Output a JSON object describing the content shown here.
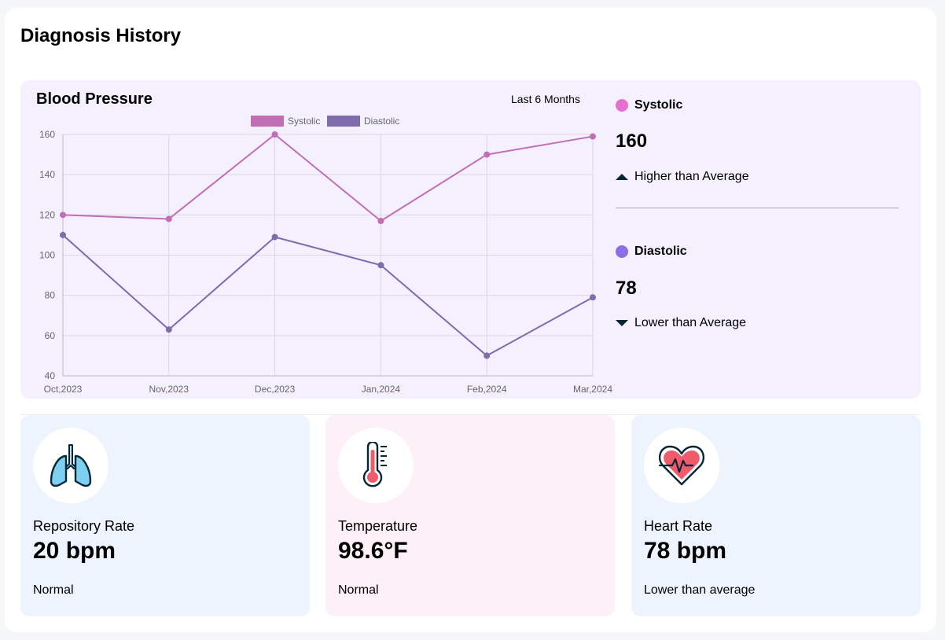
{
  "page": {
    "title": "Diagnosis History"
  },
  "blood_pressure": {
    "title": "Blood Pressure",
    "range_label": "Last 6 Months",
    "systolic": {
      "label": "Systolic",
      "value": "160",
      "trend": "Higher than Average",
      "color": "#e66fd2"
    },
    "diastolic": {
      "label": "Diastolic",
      "value": "78",
      "trend": "Lower than Average",
      "color": "#8c6fe6"
    }
  },
  "chart_data": {
    "type": "line",
    "x": [
      "Oct,2023",
      "Nov,2023",
      "Dec,2023",
      "Jan,2024",
      "Feb,2024",
      "Mar,2024"
    ],
    "series": [
      {
        "name": "Systolic",
        "values": [
          120,
          118,
          160,
          117,
          150,
          159
        ],
        "color": "#c26eb4"
      },
      {
        "name": "Diastolic",
        "values": [
          110,
          63,
          109,
          95,
          50,
          79
        ],
        "color": "#7e6cab"
      }
    ],
    "ylim": [
      40,
      160
    ],
    "yticks": [
      40,
      60,
      80,
      100,
      120,
      140,
      160
    ],
    "grid": true,
    "legend": "top-center"
  },
  "vitals": [
    {
      "label": "Repository Rate",
      "value": "20 bpm",
      "status": "Normal",
      "bg": "#e0f3fa",
      "icon": "lungs-icon"
    },
    {
      "label": "Temperature",
      "value": "98.6°F",
      "status": "Normal",
      "bg": "#ffe6e9",
      "icon": "thermometer-icon"
    },
    {
      "label": "Heart Rate",
      "value": "78 bpm",
      "status": "Lower than average",
      "bg": "#ffe6f1",
      "icon": "heart-rate-icon"
    }
  ]
}
